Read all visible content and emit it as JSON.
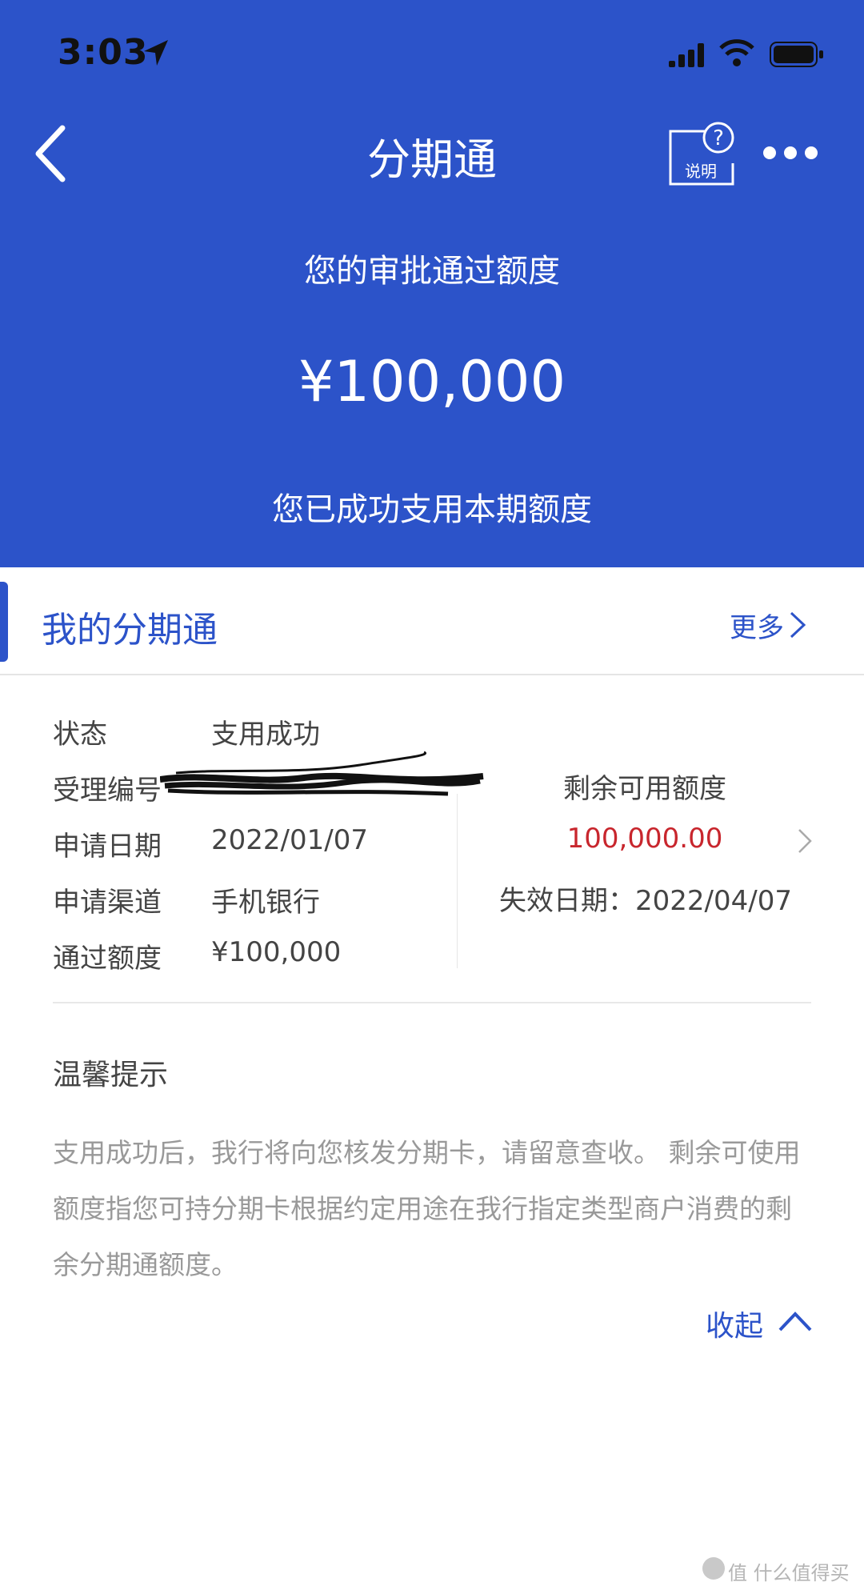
{
  "status_bar": {
    "time": "3:03"
  },
  "nav": {
    "title": "分期通",
    "help_label": "说明"
  },
  "header": {
    "approved_label": "您的审批通过额度",
    "approved_amount": "¥100,000",
    "success_text": "您已成功支用本期额度"
  },
  "section": {
    "title": "我的分期通",
    "more_label": "更多"
  },
  "details": {
    "status_label": "状态",
    "status_value": "支用成功",
    "acceptance_label": "受理编号",
    "apply_date_label": "申请日期",
    "apply_date_value": "2022/01/07",
    "channel_label": "申请渠道",
    "channel_value": "手机银行",
    "approved_label": "通过额度",
    "approved_value": "¥100,000"
  },
  "remaining": {
    "label": "剩余可用额度",
    "value": "100,000.00",
    "expire": "失效日期：2022/04/07"
  },
  "tips": {
    "title": "温馨提示",
    "body": "支用成功后，我行将向您核发分期卡，请留意查收。 剩余可使用额度指您可持分期卡根据约定用途在我行指定类型商户消费的剩余分期通额度。",
    "collapse_label": "收起"
  },
  "watermark": "值 什么值得买",
  "colors": {
    "primary": "#2c53c9",
    "amount_red": "#c8262d",
    "muted": "#999999"
  }
}
